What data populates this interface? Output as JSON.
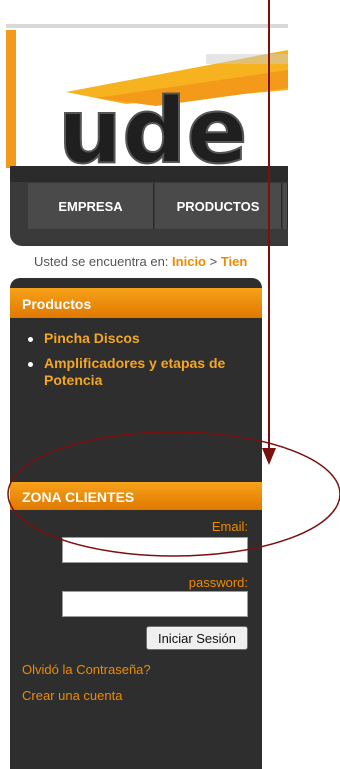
{
  "logo": {
    "text": "ude"
  },
  "nav": {
    "tabs": [
      "EMPRESA",
      "PRODUCTOS"
    ]
  },
  "breadcrumb": {
    "prefix": "Usted se encuentra en:",
    "home": "Inicio",
    "sep": ">",
    "current": "Tien"
  },
  "sidebar": {
    "products_title": "Productos",
    "products": [
      "Pincha Discos",
      "Amplificadores y etapas de Potencia"
    ],
    "clients_title": "ZONA CLIENTES",
    "email_label": "Email:",
    "password_label": "password:",
    "login_button": "Iniciar Sesión",
    "forgot_link": "Olvidó la Contraseña?",
    "create_link": "Crear una cuenta"
  },
  "colors": {
    "accent": "#f08a00",
    "annotation": "#7a1010",
    "sidebar_bg": "#2e2e2e"
  }
}
